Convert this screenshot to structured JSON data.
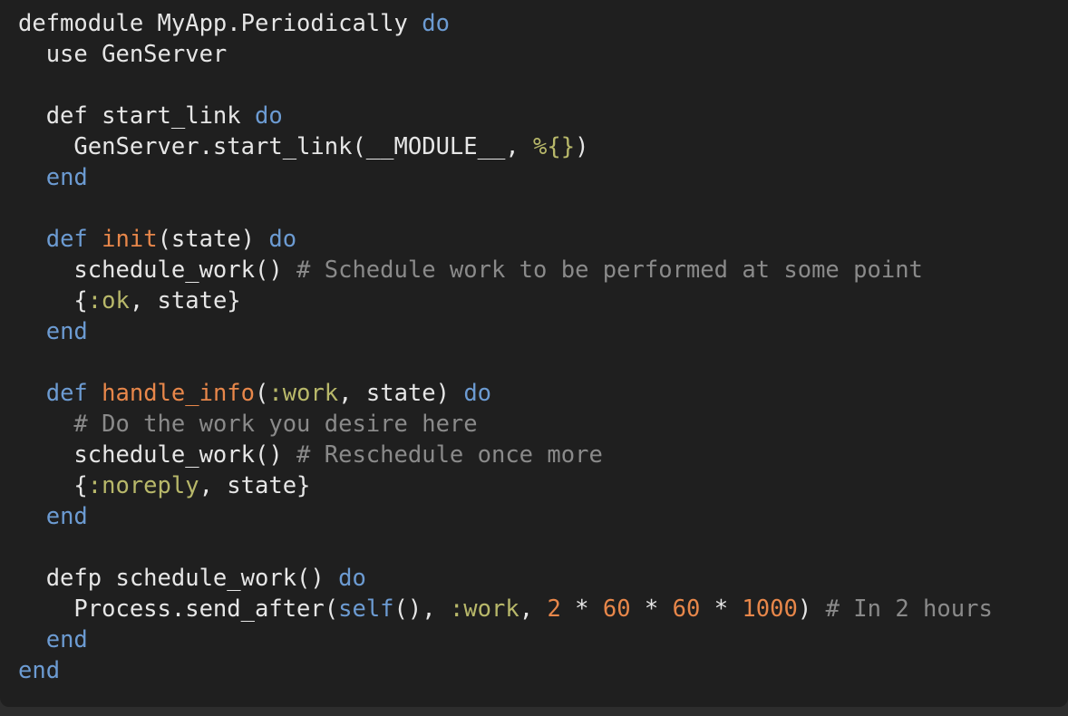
{
  "colors": {
    "background": "#1f1f1f",
    "outer": "#2d2d2d",
    "default": "#e6e6e6",
    "keyword": "#6c9bd2",
    "function_name": "#e8874a",
    "atom": "#b8b86a",
    "number": "#e8874a",
    "comment": "#8a8a8a",
    "map": "#b8b86a"
  },
  "code_lines": [
    [
      [
        "t",
        "defmodule MyApp.Periodically "
      ],
      [
        "kw",
        "do"
      ]
    ],
    [
      [
        "t",
        "  use GenServer"
      ]
    ],
    [],
    [
      [
        "t",
        "  def start_link "
      ],
      [
        "kw",
        "do"
      ]
    ],
    [
      [
        "t",
        "    GenServer.start_link(__MODULE__, "
      ],
      [
        "map",
        "%{}"
      ],
      [
        "t",
        ")"
      ]
    ],
    [
      [
        "t",
        "  "
      ],
      [
        "kw",
        "end"
      ]
    ],
    [],
    [
      [
        "t",
        "  "
      ],
      [
        "kw",
        "def"
      ],
      [
        "t",
        " "
      ],
      [
        "fn",
        "init"
      ],
      [
        "t",
        "(state) "
      ],
      [
        "kw",
        "do"
      ]
    ],
    [
      [
        "t",
        "    schedule_work() "
      ],
      [
        "cm",
        "# Schedule work to be performed at some point"
      ]
    ],
    [
      [
        "t",
        "    {"
      ],
      [
        "at",
        ":ok"
      ],
      [
        "t",
        ", state}"
      ]
    ],
    [
      [
        "t",
        "  "
      ],
      [
        "kw",
        "end"
      ]
    ],
    [],
    [
      [
        "t",
        "  "
      ],
      [
        "kw",
        "def"
      ],
      [
        "t",
        " "
      ],
      [
        "fn",
        "handle_info"
      ],
      [
        "t",
        "("
      ],
      [
        "at",
        ":work"
      ],
      [
        "t",
        ", state) "
      ],
      [
        "kw",
        "do"
      ]
    ],
    [
      [
        "t",
        "    "
      ],
      [
        "cm",
        "# Do the work you desire here"
      ]
    ],
    [
      [
        "t",
        "    schedule_work() "
      ],
      [
        "cm",
        "# Reschedule once more"
      ]
    ],
    [
      [
        "t",
        "    {"
      ],
      [
        "at",
        ":noreply"
      ],
      [
        "t",
        ", state}"
      ]
    ],
    [
      [
        "t",
        "  "
      ],
      [
        "kw",
        "end"
      ]
    ],
    [],
    [
      [
        "t",
        "  defp schedule_work() "
      ],
      [
        "kw",
        "do"
      ]
    ],
    [
      [
        "t",
        "    Process.send_after("
      ],
      [
        "kw",
        "self"
      ],
      [
        "t",
        "(), "
      ],
      [
        "at",
        ":work"
      ],
      [
        "t",
        ", "
      ],
      [
        "num",
        "2"
      ],
      [
        "t",
        " * "
      ],
      [
        "num",
        "60"
      ],
      [
        "t",
        " * "
      ],
      [
        "num",
        "60"
      ],
      [
        "t",
        " * "
      ],
      [
        "num",
        "1000"
      ],
      [
        "t",
        ") "
      ],
      [
        "cm",
        "# In 2 hours"
      ]
    ],
    [
      [
        "t",
        "  "
      ],
      [
        "kw",
        "end"
      ]
    ],
    [
      [
        "kw",
        "end"
      ]
    ]
  ]
}
